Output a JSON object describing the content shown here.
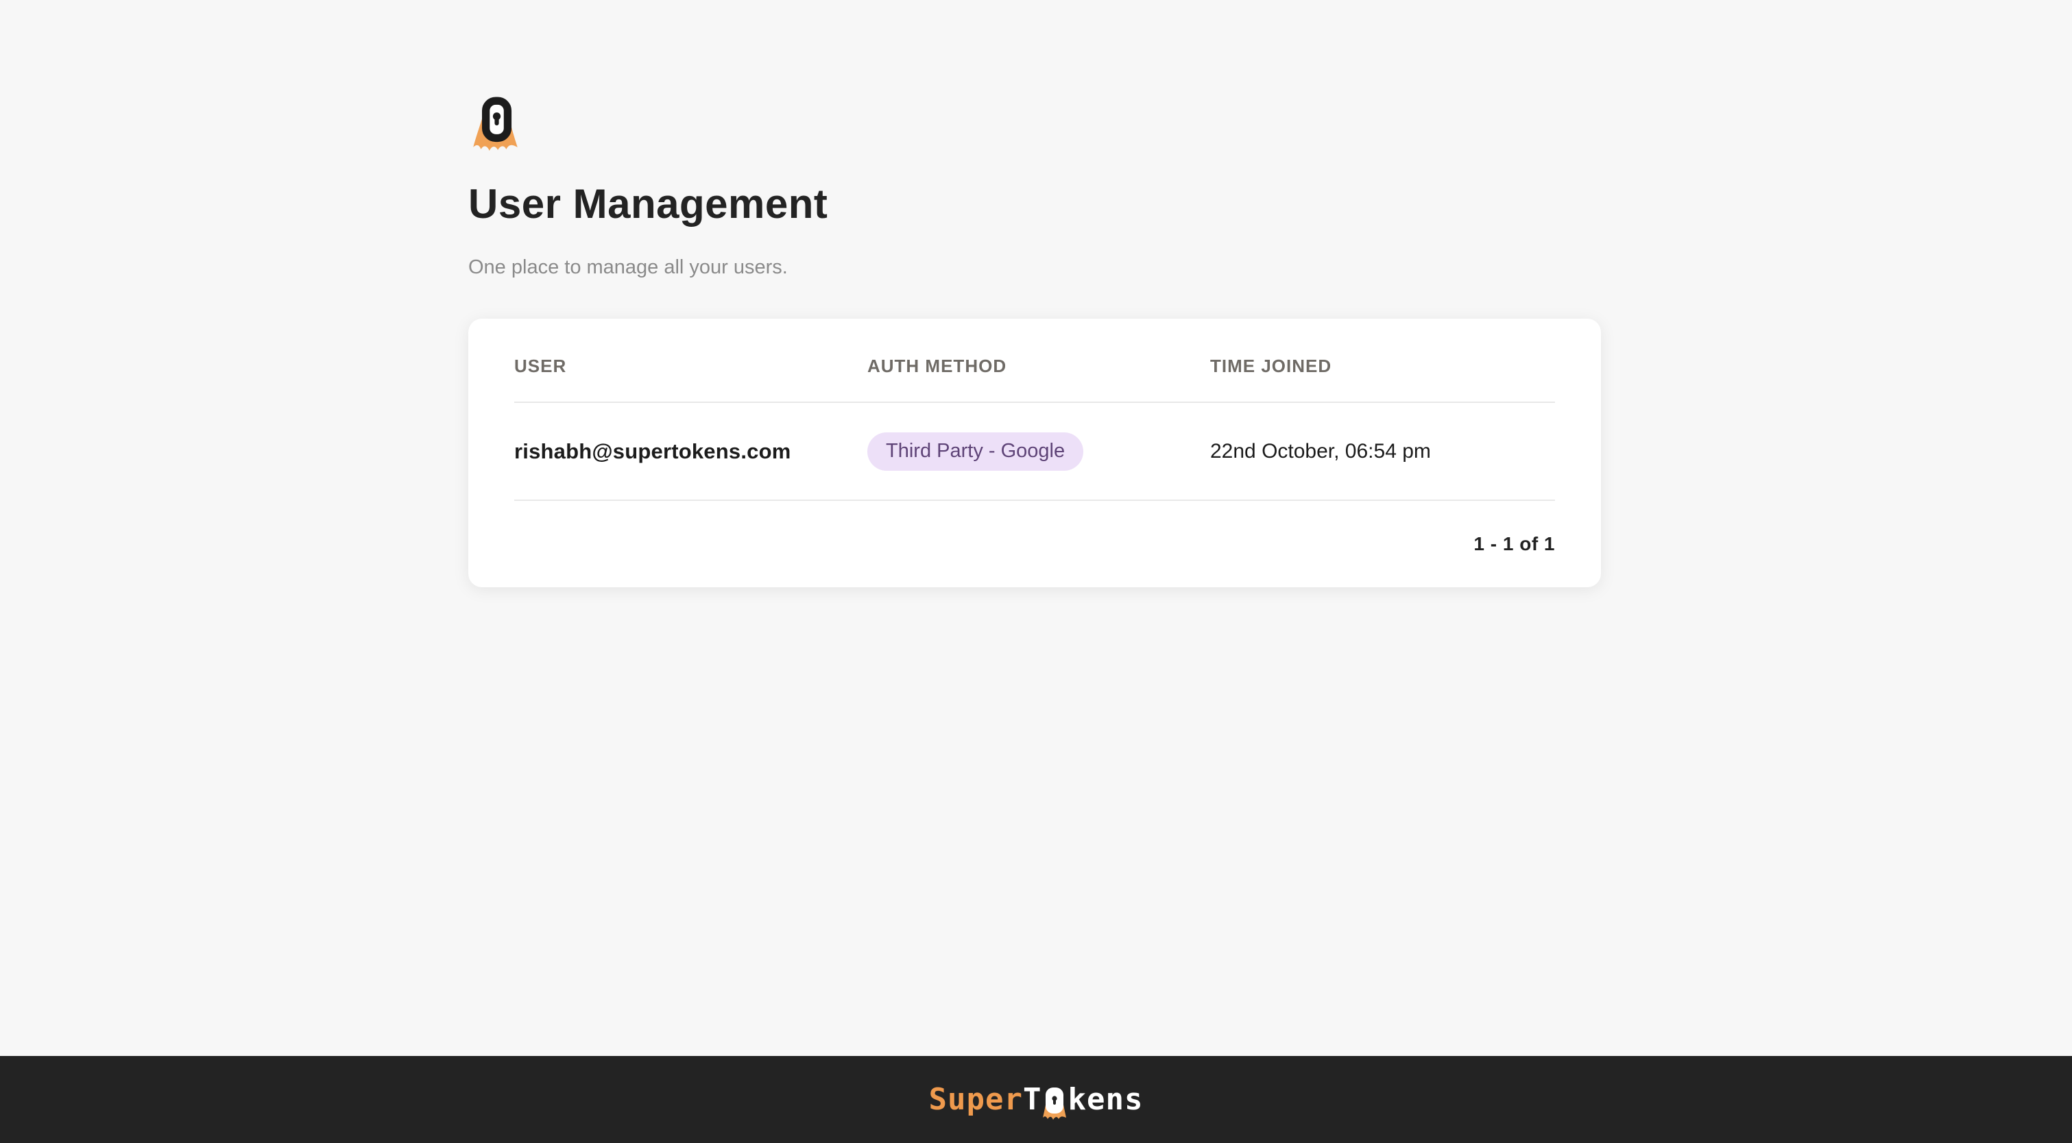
{
  "header": {
    "logo_icon": "supertokens-lock-mascot-icon",
    "title": "User Management",
    "subtitle": "One place to manage all your users."
  },
  "table": {
    "columns": [
      "USER",
      "AUTH METHOD",
      "TIME JOINED"
    ],
    "rows": [
      {
        "user": "rishabh@supertokens.com",
        "auth_method": "Third Party - Google",
        "time_joined": "22nd October, 06:54 pm"
      }
    ],
    "pagination": "1 - 1 of 1"
  },
  "footer": {
    "brand_super": "Super",
    "brand_tokens_t": "T",
    "brand_tokens_rest": "kens"
  },
  "colors": {
    "page_background": "#F7F7F7",
    "card_background": "#FFFFFF",
    "badge_background": "#EDE0F8",
    "badge_text": "#5E4377",
    "brand_orange": "#EF9A4D",
    "footer_background": "#232323",
    "mascot_cape_orange": "#F0A155",
    "mascot_body_black": "#1C1C1C"
  }
}
